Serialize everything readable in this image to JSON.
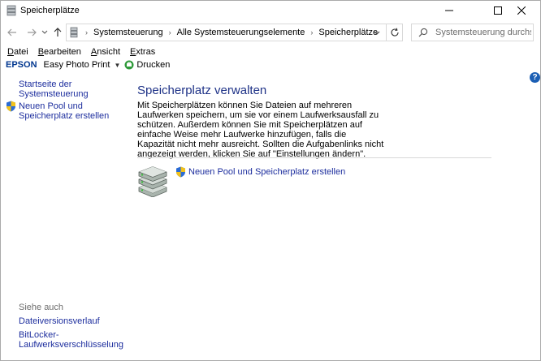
{
  "window": {
    "title": "Speicherplätze",
    "controls": {
      "minimize": "minimize-icon",
      "maximize": "maximize-icon",
      "close": "close-icon"
    }
  },
  "address_bar": {
    "breadcrumbs": [
      "Systemsteuerung",
      "Alle Systemsteuerungselemente",
      "Speicherplätze"
    ],
    "search_placeholder": "Systemsteuerung durchsuch..."
  },
  "menu": {
    "items": [
      {
        "accel": "D",
        "rest": "atei"
      },
      {
        "accel": "B",
        "rest": "earbeiten"
      },
      {
        "accel": "A",
        "rest": "nsicht"
      },
      {
        "accel": "E",
        "rest": "xtras"
      }
    ]
  },
  "epson_toolbar": {
    "logo": "EPSON",
    "app": "Easy Photo Print",
    "print": "Drucken"
  },
  "sidebar": {
    "home_link": "Startseite der Systemsteuerung",
    "new_pool_link": "Neuen Pool und Speicherplatz erstellen",
    "see_also_label": "Siehe auch",
    "see_also": [
      "Dateiversionsverlauf",
      "BitLocker-Laufwerksverschlüsselung"
    ]
  },
  "main": {
    "title": "Speicherplatz verwalten",
    "description": "Mit Speicherplätzen können Sie Dateien auf mehreren Laufwerken speichern, um sie vor einem Laufwerksausfall zu schützen. Außerdem können Sie mit Speicherplätzen auf einfache Weise mehr Laufwerke hinzufügen, falls die Kapazität nicht mehr ausreicht. Sollten die Aufgabenlinks nicht angezeigt werden, klicken Sie auf \"Einstellungen ändern\".",
    "task_link": "Neuen Pool und Speicherplatz erstellen"
  },
  "help": "?",
  "colors": {
    "link": "#1d2e9e",
    "title": "#1e3287",
    "epson": "#00368f",
    "help": "#1c5fb4"
  }
}
